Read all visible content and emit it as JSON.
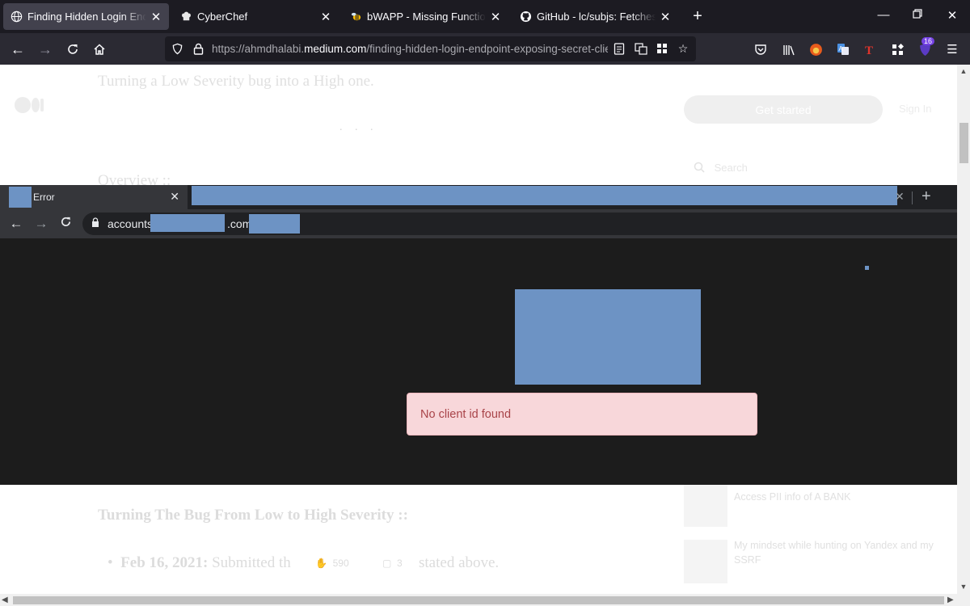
{
  "firefox": {
    "tabs": [
      {
        "title": "Finding Hidden Login Endpoint",
        "icon": "globe-icon",
        "active": true
      },
      {
        "title": "CyberChef",
        "icon": "chef-hat-icon",
        "active": false
      },
      {
        "title": "bWAPP - Missing Functional Lev",
        "icon": "bee-icon",
        "active": false
      },
      {
        "title": "GitHub - lc/subjs: Fetches javasc",
        "icon": "github-icon",
        "active": false
      }
    ],
    "url_prefix": "https://ahmdhalabi.",
    "url_domain": "medium.com",
    "url_path": "/finding-hidden-login-endpoint-exposing-secret-clie",
    "extension_badge": "16"
  },
  "medium_page": {
    "subtitle": "Turning a Low Severity bug into a High one.",
    "loading_dots": ". . .",
    "overview_heading": "Overview ::",
    "get_started_label": "Get started",
    "sign_in_label": "Sign In",
    "search_placeholder": "Search",
    "section_heading": "Turning The Bug From Low to High Severity ::",
    "bullet_date": "Feb 16, 2021:",
    "bullet_text_start": " Submitted th",
    "bullet_text_end": "stated above.",
    "clap_count": "590",
    "response_count": "3",
    "sidebar_posts": [
      {
        "title": "Access PII info of A BANK"
      },
      {
        "title": "My mindset while hunting on Yandex and my SSRF"
      }
    ]
  },
  "chrome_shot": {
    "tab_title": "Error",
    "url_prefix": "accounts",
    "url_middle": ".com/",
    "alert_message": "No client id found"
  },
  "colors": {
    "redaction": "#6d93c4",
    "alert_bg": "#f8d7da",
    "alert_text": "#a94449"
  }
}
